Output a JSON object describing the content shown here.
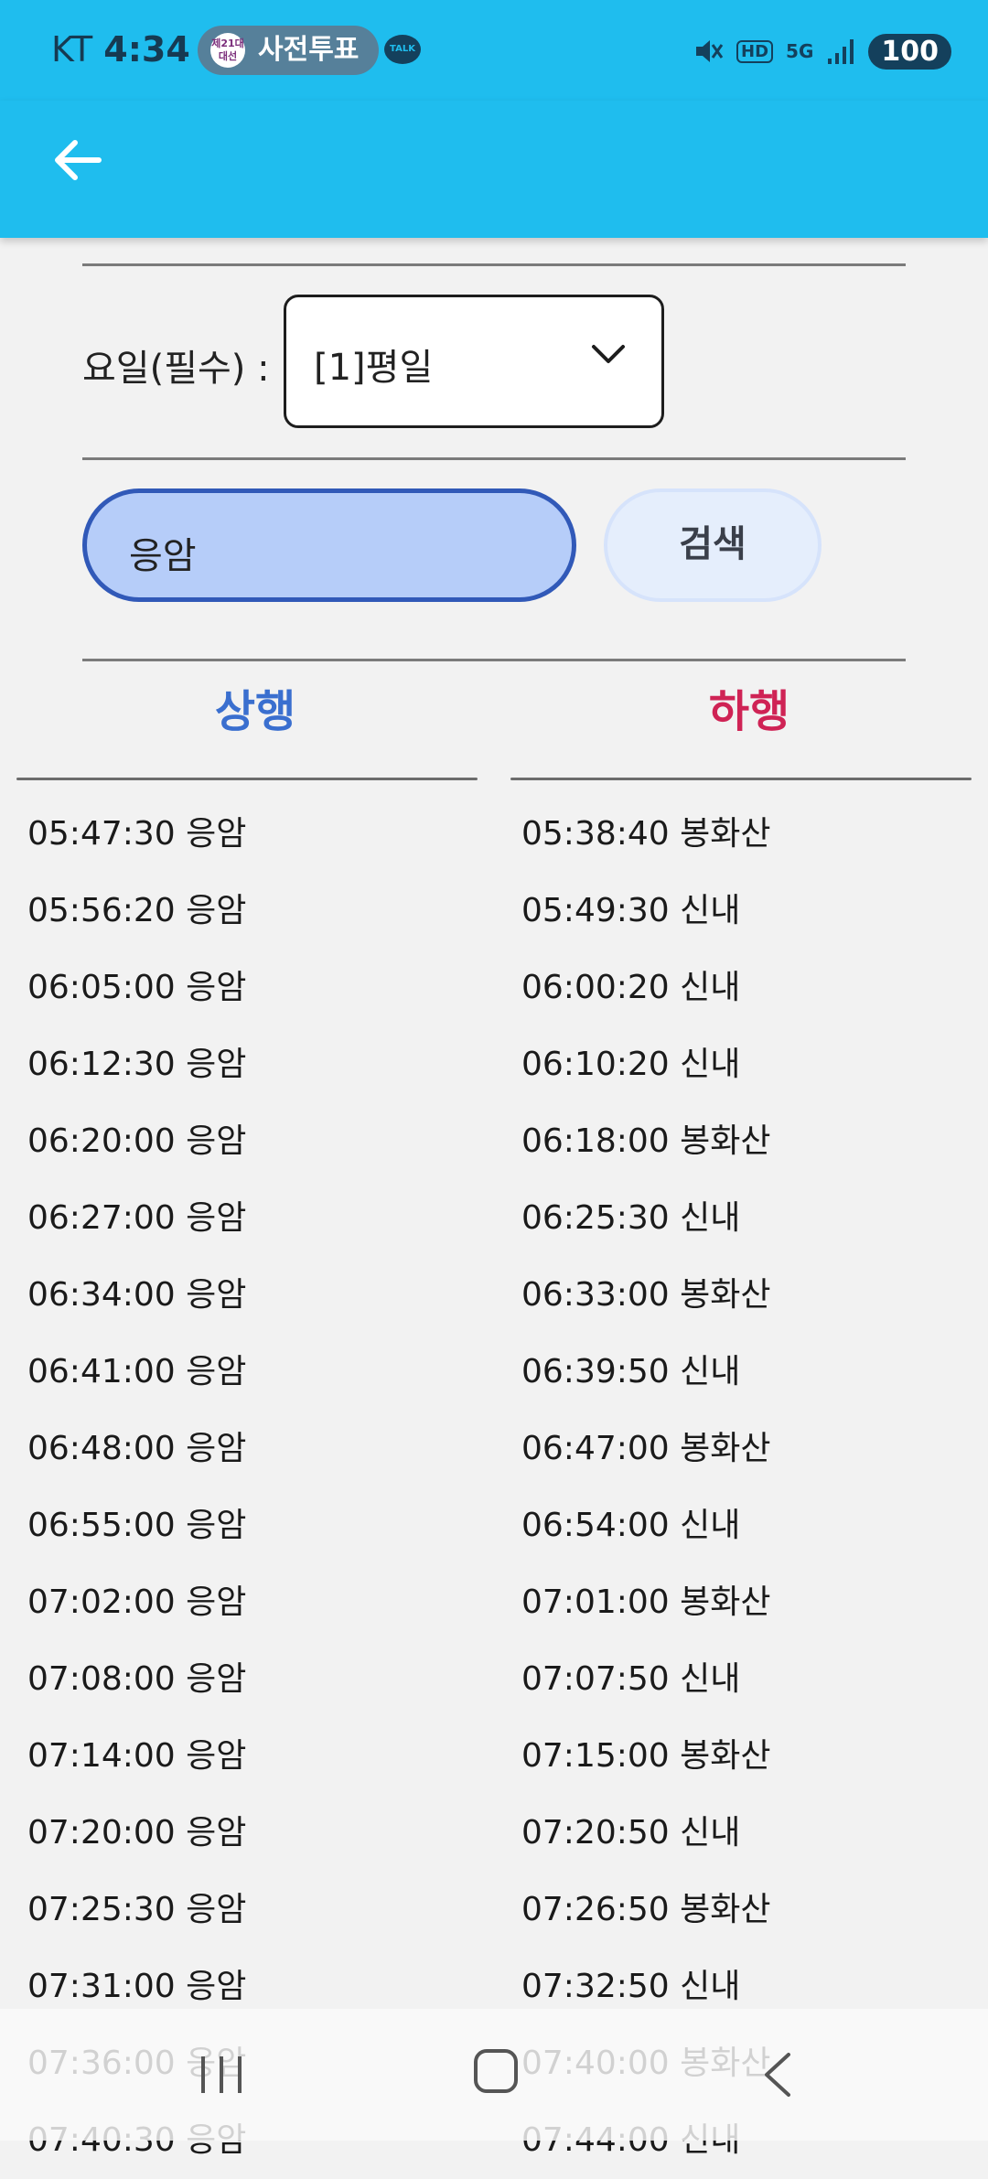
{
  "status_bar": {
    "carrier": "KT",
    "time": "4:34",
    "vote_badge": "제21대 대선",
    "vote_label": "사전투표",
    "talk_label": "TALK",
    "network_hd": "HD",
    "network_5g": "5G",
    "battery": "100"
  },
  "app_bar": {
    "back_icon": "arrow-left-icon"
  },
  "filter": {
    "day_label": "요일(필수) :",
    "day_value": "[1]평일"
  },
  "search": {
    "value": "응암",
    "button_label": "검색"
  },
  "tabs": {
    "up_label": "상행",
    "down_label": "하행",
    "up_color": "#3a6fcf",
    "down_color": "#cf2355"
  },
  "schedule": {
    "up": [
      "05:47:30 응암",
      "05:56:20 응암",
      "06:05:00 응암",
      "06:12:30 응암",
      "06:20:00 응암",
      "06:27:00 응암",
      "06:34:00 응암",
      "06:41:00 응암",
      "06:48:00 응암",
      "06:55:00 응암",
      "07:02:00 응암",
      "07:08:00 응암",
      "07:14:00 응암",
      "07:20:00 응암",
      "07:25:30 응암",
      "07:31:00 응암",
      "07:36:00 응암",
      "07:40:30 응암"
    ],
    "down": [
      "05:38:40 봉화산",
      "05:49:30 신내",
      "06:00:20 신내",
      "06:10:20 신내",
      "06:18:00 봉화산",
      "06:25:30 신내",
      "06:33:00 봉화산",
      "06:39:50 신내",
      "06:47:00 봉화산",
      "06:54:00 신내",
      "07:01:00 봉화산",
      "07:07:50 신내",
      "07:15:00 봉화산",
      "07:20:50 신내",
      "07:26:50 봉화산",
      "07:32:50 신내",
      "07:40:00 봉화산",
      "07:44:00 신내"
    ]
  },
  "colors": {
    "app_bar": "#1fbdee",
    "search_field": "#b6cdf9",
    "search_border": "#3159b8"
  }
}
